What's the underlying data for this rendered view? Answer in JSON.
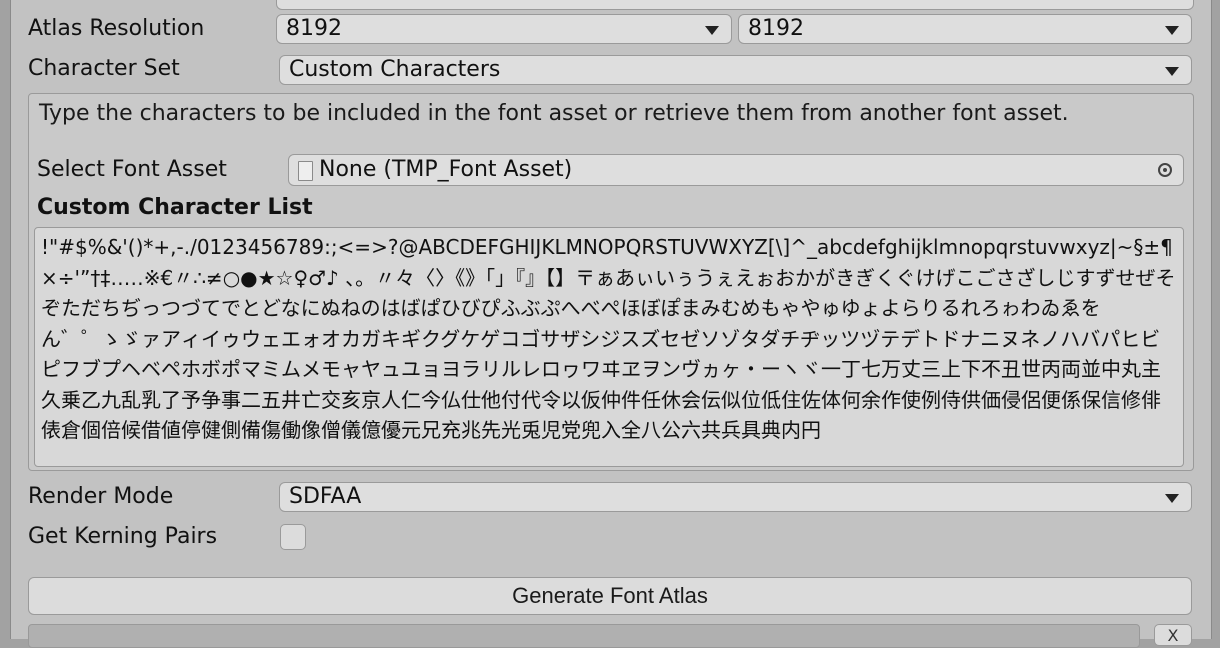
{
  "atlas_resolution": {
    "label": "Atlas Resolution",
    "width": "8192",
    "height": "8192"
  },
  "character_set": {
    "label": "Character Set",
    "value": "Custom Characters"
  },
  "help_text": "Type the characters to be included in the font asset or retrieve them from another font asset.",
  "select_font_asset": {
    "label": "Select Font Asset",
    "value": "None (TMP_Font Asset)",
    "icon": "document-icon",
    "picker_icon": "object-picker-icon"
  },
  "custom_character_list": {
    "title": "Custom Character List",
    "value": "!\"#$%&'()*+,-./0123456789:;<=>?@ABCDEFGHIJKLMNOPQRSTUVWXYZ[\\]^_abcdefghijklmnopqrstuvwxyz|~§±¶×÷'”†‡…‥※€〃∴≠○●★☆♀♂♪ 、。〃々〈〉《》「」『』【】〒ぁあぃいぅうぇえぉおかがきぎくぐけげこごさざしじすずせぜそぞただちぢっつづてでとどなにぬねのはばぱひびぴふぶぷへべぺほぼぽまみむめもゃやゅゆょよらりるれろゎわゐゑをん゛゜ゝゞァアィイゥウェエォオカガキギクグケゲコゴサザシジスズセゼソゾタダチヂッツヅテデトドナニヌネノハバパヒビピフブプヘベペホボポマミムメモャヤュユョヨラリルレロヮワヰヱヲンヴヵヶ・ーヽヾ一丁七万丈三上下不丑世丙両並中丸主久乗乙九乱乳了予争事二五井亡交亥京人仁今仏仕他付代令以仮仲件任休会伝似位低住佐体何余作使例侍供価侵侶便係保信修俳俵倉個倍候借値停健側備傷働像僧儀億優元兄充兆先光兎児党兜入全八公六共兵具典内円"
  },
  "render_mode": {
    "label": "Render Mode",
    "value": "SDFAA"
  },
  "kerning": {
    "label": "Get Kerning Pairs",
    "checked": false
  },
  "generate_button": "Generate Font Atlas",
  "mini_button": "X"
}
